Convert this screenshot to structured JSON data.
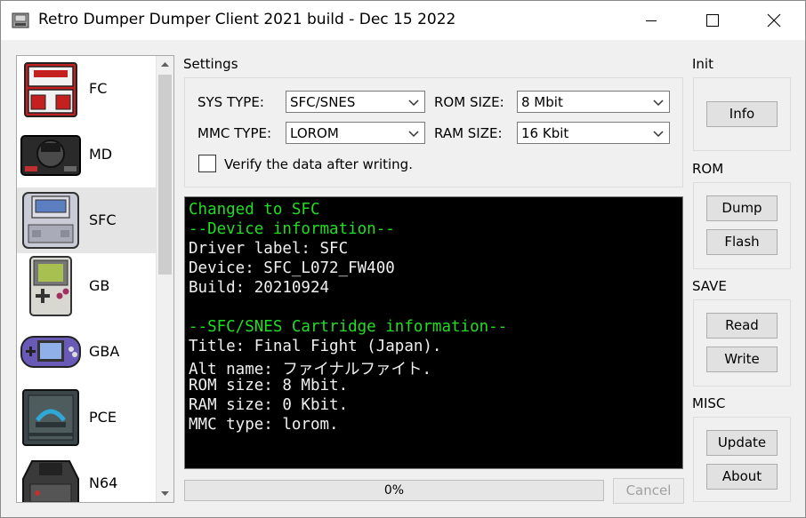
{
  "window": {
    "title": "Retro Dumper Dumper Client 2021 build - Dec 15 2022"
  },
  "consoles": [
    {
      "label": "FC"
    },
    {
      "label": "MD"
    },
    {
      "label": "SFC"
    },
    {
      "label": "GB"
    },
    {
      "label": "GBA"
    },
    {
      "label": "PCE"
    },
    {
      "label": "N64"
    }
  ],
  "settings": {
    "group_label": "Settings",
    "sys_type_label": "SYS TYPE:",
    "sys_type_value": "SFC/SNES",
    "rom_size_label": "ROM SIZE:",
    "rom_size_value": "8 Mbit",
    "mmc_type_label": "MMC TYPE:",
    "mmc_type_value": "LOROM",
    "ram_size_label": "RAM SIZE:",
    "ram_size_value": "16 Kbit",
    "verify_label": "Verify the data after writing."
  },
  "log": {
    "lines": [
      {
        "text": "Changed to SFC",
        "color": "#22dd22"
      },
      {
        "text": "--Device information--",
        "color": "#22dd22"
      },
      {
        "text": "Driver label: SFC",
        "color": "#f0f0f0"
      },
      {
        "text": "Device: SFC_L072_FW400",
        "color": "#f0f0f0"
      },
      {
        "text": "Build: 20210924",
        "color": "#f0f0f0"
      },
      {
        "text": "",
        "color": "#f0f0f0"
      },
      {
        "text": "--SFC/SNES Cartridge information--",
        "color": "#22dd22"
      },
      {
        "text": "Title: Final Fight (Japan).",
        "color": "#f0f0f0"
      },
      {
        "text": "Alt name: ファイナルファイト.",
        "color": "#f0f0f0"
      },
      {
        "text": "ROM size: 8 Mbit.",
        "color": "#f0f0f0"
      },
      {
        "text": "RAM size: 0 Kbit.",
        "color": "#f0f0f0"
      },
      {
        "text": "MMC type: lorom.",
        "color": "#f0f0f0"
      }
    ]
  },
  "progress": {
    "text": "0%",
    "value": 0
  },
  "cancel_label": "Cancel",
  "init": {
    "label": "Init",
    "info_button": "Info"
  },
  "rom": {
    "label": "ROM",
    "dump_button": "Dump",
    "flash_button": "Flash"
  },
  "save": {
    "label": "SAVE",
    "read_button": "Read",
    "write_button": "Write"
  },
  "misc": {
    "label": "MISC",
    "update_button": "Update",
    "about_button": "About"
  },
  "icons": {
    "app": "retro-dumper-icon",
    "minimize": "minimize-icon",
    "maximize": "maximize-icon",
    "close": "close-icon",
    "dropdown": "chevron-down-icon"
  }
}
